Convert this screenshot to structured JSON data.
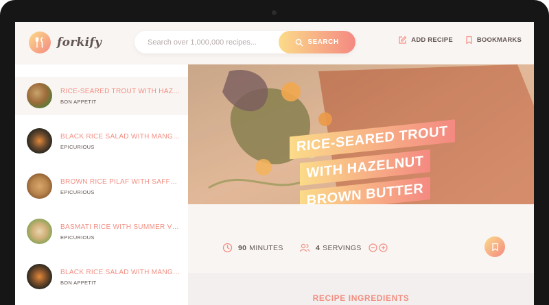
{
  "app": {
    "name": "forkify"
  },
  "header": {
    "search": {
      "placeholder": "Search over 1,000,000 recipes...",
      "button_label": "SEARCH",
      "button_icon": "search-icon"
    },
    "nav": [
      {
        "label": "ADD RECIPE",
        "icon": "edit-icon"
      },
      {
        "label": "BOOKMARKS",
        "icon": "bookmark-icon"
      }
    ]
  },
  "results": [
    {
      "title": "RICE-SEARED TROUT WITH HAZE...",
      "publisher": "BON APPETIT",
      "active": true
    },
    {
      "title": "BLACK RICE SALAD WITH MANGO...",
      "publisher": "EPICURIOUS",
      "active": false
    },
    {
      "title": "BROWN RICE PILAF WITH SAFFR...",
      "publisher": "EPICURIOUS",
      "active": false
    },
    {
      "title": "BASMATI RICE WITH SUMMER VE...",
      "publisher": "EPICURIOUS",
      "active": false
    },
    {
      "title": "BLACK RICE SALAD WITH MANGO...",
      "publisher": "BON APPETIT",
      "active": false
    }
  ],
  "recipe": {
    "title_lines": [
      "RICE-SEARED TROUT",
      "WITH HAZELNUT",
      "BROWN BUTTER"
    ],
    "cooking_time": "90",
    "time_unit": "MINUTES",
    "servings": "4",
    "servings_unit": "SERVINGS",
    "ingredients_heading": "RECIPE INGREDIENTS"
  },
  "colors": {
    "accent_start": "#fbdb89",
    "accent_end": "#f48982",
    "text_dark": "#615551",
    "text_accent": "#f38e82",
    "background": "#f9f5f3"
  }
}
